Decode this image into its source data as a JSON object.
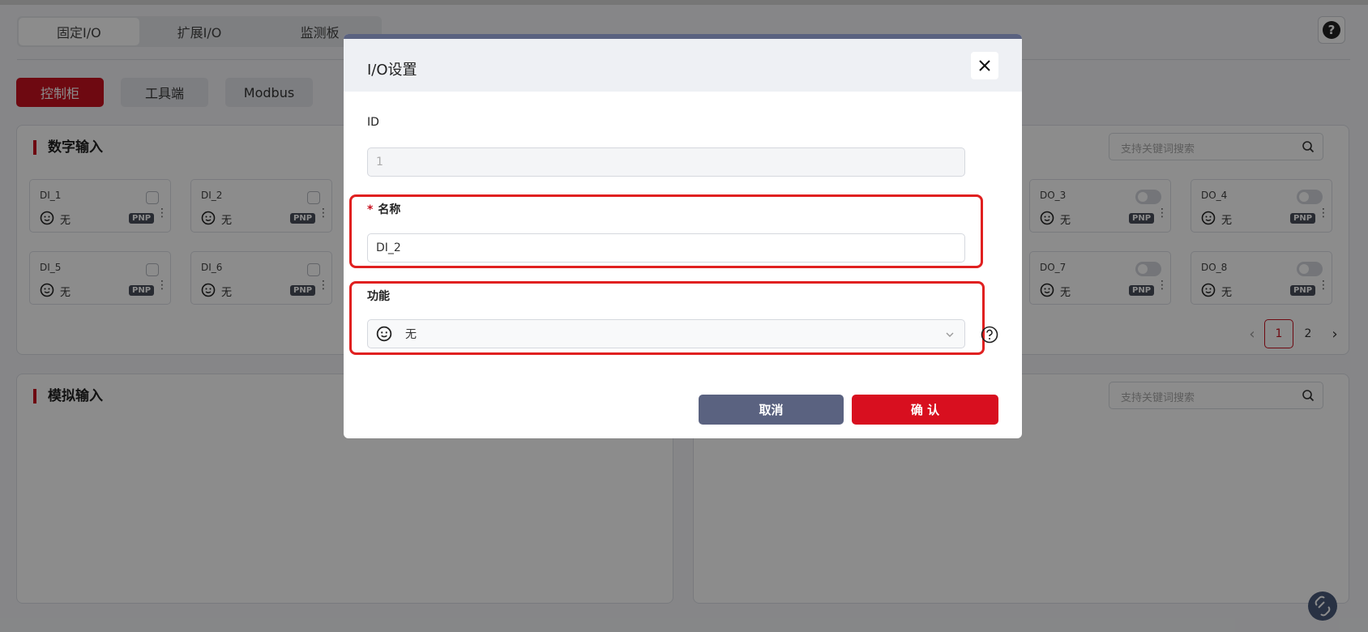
{
  "top_tabs": [
    "固定I/O",
    "扩展I/O",
    "监测板"
  ],
  "sub_tabs": [
    "控制柜",
    "工具端",
    "Modbus"
  ],
  "help_symbol": "?",
  "panels": {
    "digital_input": {
      "title": "数字输入",
      "search_placeholder": "支持关键词搜索"
    },
    "analog_input": {
      "title": "模拟输入",
      "search_placeholder": "支持关键词搜索"
    }
  },
  "di_cards": [
    {
      "name": "DI_1",
      "func": "无",
      "badge": "PNP"
    },
    {
      "name": "DI_2",
      "func": "无",
      "badge": "PNP"
    },
    {
      "name": "DI_5",
      "func": "无",
      "badge": "PNP"
    },
    {
      "name": "DI_6",
      "func": "无",
      "badge": "PNP"
    }
  ],
  "do_cards": [
    {
      "name": "DO_3",
      "func": "无",
      "badge": "PNP"
    },
    {
      "name": "DO_4",
      "func": "无",
      "badge": "PNP"
    },
    {
      "name": "DO_7",
      "func": "无",
      "badge": "PNP"
    },
    {
      "name": "DO_8",
      "func": "无",
      "badge": "PNP"
    }
  ],
  "pagination": {
    "prev": "‹",
    "pages": [
      "1",
      "2"
    ],
    "next": "›",
    "current": 1
  },
  "modal": {
    "title": "I/O设置",
    "close": "✕",
    "id_label": "ID",
    "id_value": "1",
    "name_label": "名称",
    "required_mark": "*",
    "name_value": "DI_2",
    "function_label": "功能",
    "function_value": "无",
    "cancel": "取消",
    "confirm": "确 认"
  },
  "colors": {
    "accent": "#c8111f",
    "confirm": "#d80f1f",
    "cancel": "#5a6280",
    "highlight": "#e02020"
  }
}
